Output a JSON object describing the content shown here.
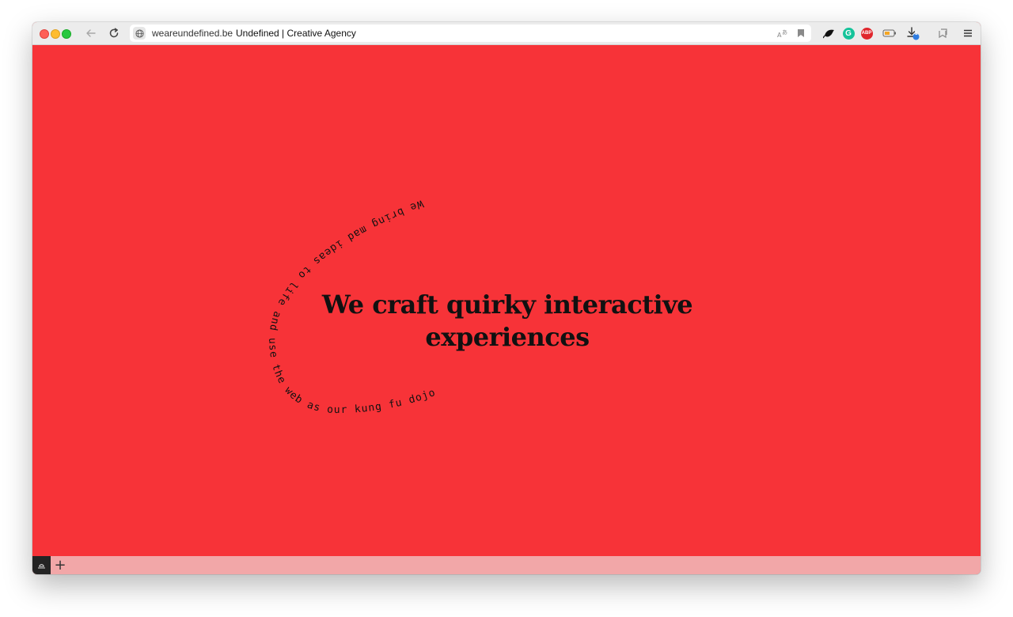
{
  "browser": {
    "url_domain": "weareundefined.be",
    "tab_title": "Undefined | Creative Agency",
    "download_badge": "1",
    "abp_label": "ABP",
    "grammarly_label": "G",
    "icons": [
      "back-arrow-icon",
      "reload-icon",
      "globe-icon",
      "translate-icon",
      "bookmark-icon",
      "extension-bird-icon",
      "grammarly-icon",
      "adblock-icon",
      "battery-icon",
      "download-icon",
      "sidebar-icon",
      "menu-icon"
    ]
  },
  "hero": {
    "headline_line1": "We craft quirky interactive",
    "headline_line2": "experiences",
    "curved_text": "We bring mad ideas to life and use the web as our kung fu dojo"
  },
  "bottom_bar": {
    "plus_label": "+",
    "icons": [
      "scale-icon",
      "plus-icon"
    ]
  },
  "colors": {
    "page_background": "#f73338",
    "text": "#111111",
    "bottom_bar": "#f2a7a8"
  }
}
